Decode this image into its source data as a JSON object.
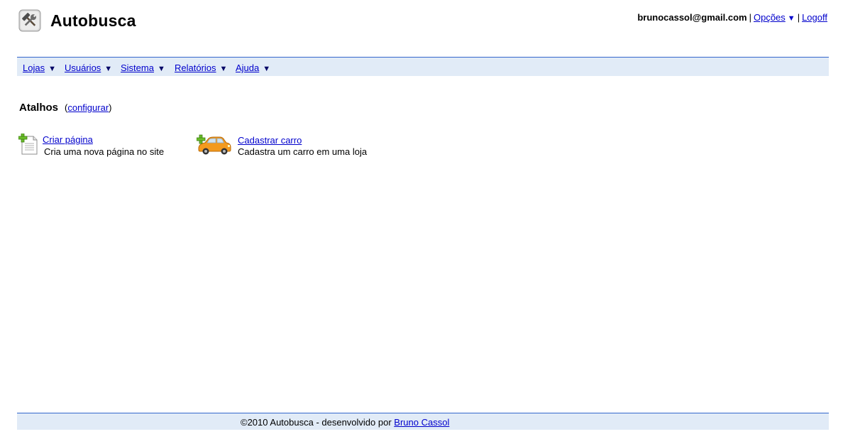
{
  "header": {
    "app_title": "Autobusca",
    "logo_icon": "tools-icon",
    "user_email": "brunocassol@gmail.com",
    "options_label": "Opções",
    "logoff_label": "Logoff"
  },
  "menu": {
    "items": [
      {
        "label": "Lojas"
      },
      {
        "label": "Usuários"
      },
      {
        "label": "Sistema"
      },
      {
        "label": "Relatórios"
      },
      {
        "label": "Ajuda"
      }
    ]
  },
  "shortcuts": {
    "title": "Atalhos",
    "configure_label": "configurar",
    "items": [
      {
        "icon": "add-page-icon",
        "label": "Criar página",
        "description": "Cria uma nova página no site"
      },
      {
        "icon": "add-car-icon",
        "label": "Cadastrar carro",
        "description": "Cadastra um carro em uma loja"
      }
    ]
  },
  "footer": {
    "copyright": "©2010  Autobusca -  desenvolvido por",
    "author_label": "Bruno Cassol"
  },
  "colors": {
    "link": "#0000cc",
    "bar_background": "#e1ebf7",
    "bar_border": "#3366cc"
  }
}
